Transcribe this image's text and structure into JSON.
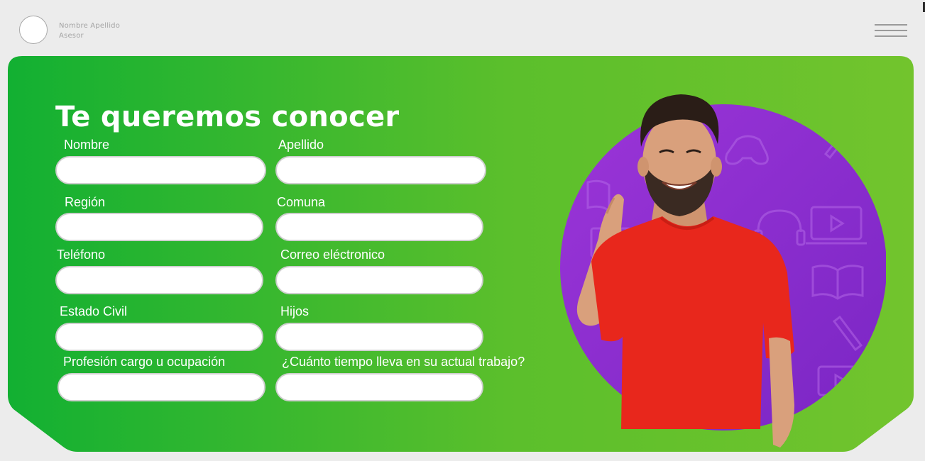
{
  "header": {
    "user_name": "Nombre Apellido",
    "user_role": "Asesor",
    "menu_icon": "hamburger-menu-icon"
  },
  "form": {
    "title": "Te queremos conocer",
    "fields": [
      {
        "label": "Nombre",
        "value": "",
        "placeholder": ""
      },
      {
        "label": "Apellido",
        "value": "",
        "placeholder": ""
      },
      {
        "label": "Región",
        "value": "",
        "placeholder": ""
      },
      {
        "label": "Comuna",
        "value": "",
        "placeholder": ""
      },
      {
        "label": "Teléfono",
        "value": "",
        "placeholder": ""
      },
      {
        "label": "Correo eléctronico",
        "value": "",
        "placeholder": ""
      },
      {
        "label": "Estado Civil",
        "value": "",
        "placeholder": ""
      },
      {
        "label": "Hijos",
        "value": "",
        "placeholder": ""
      },
      {
        "label": "Profesión cargo u ocupación",
        "value": "",
        "placeholder": ""
      },
      {
        "label": "¿Cuánto tiempo lleva en su actual trabajo?",
        "value": "",
        "placeholder": ""
      }
    ]
  },
  "colors": {
    "page_background": "#ececec",
    "card_green_left": "#12b032",
    "card_green_right": "#6cc22c",
    "hero_circle": "#8a2ed0",
    "shirt": "#e8271c"
  }
}
